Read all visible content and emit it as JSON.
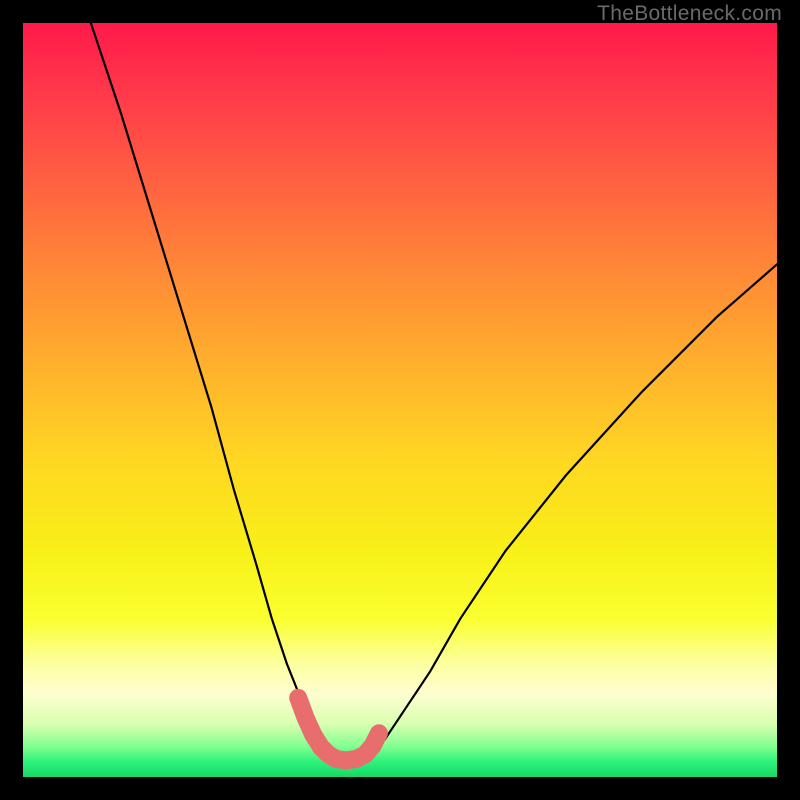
{
  "attribution": "TheBottleneck.com",
  "chart_data": {
    "type": "line",
    "title": "",
    "xlabel": "",
    "ylabel": "",
    "xlim": [
      0,
      100
    ],
    "ylim": [
      0,
      100
    ],
    "series": [
      {
        "name": "bottleneck-curve",
        "x": [
          9,
          13,
          17,
          21,
          25,
          28,
          31,
          33,
          35,
          37,
          38.5,
          40,
          41,
          42,
          43,
          44,
          46,
          48,
          50,
          54,
          58,
          64,
          72,
          82,
          92,
          100
        ],
        "y": [
          100,
          88,
          75,
          62,
          49,
          38,
          28,
          21,
          15,
          10,
          6,
          3.5,
          2.5,
          2,
          2,
          2.2,
          3,
          5,
          8,
          14,
          21,
          30,
          40,
          51,
          61,
          68
        ]
      }
    ],
    "highlight": {
      "name": "valley-marker",
      "color": "#e86d6d",
      "x": [
        36.5,
        37.5,
        38.5,
        39.5,
        40.5,
        41.5,
        42.8,
        44.2,
        45.4,
        46.4,
        47.2
      ],
      "y": [
        10.5,
        7.8,
        5.6,
        4.0,
        3.0,
        2.4,
        2.2,
        2.4,
        3.0,
        4.2,
        5.8
      ]
    }
  }
}
